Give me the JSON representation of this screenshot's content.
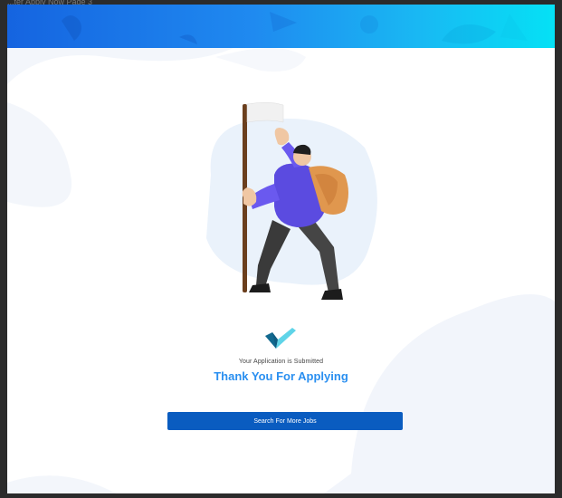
{
  "window": {
    "title": "...ter Apply Now Page 3"
  },
  "confirmation": {
    "subtitle": "Your Application is Submitted",
    "title": "Thank You For Applying"
  },
  "actions": {
    "search_more_jobs_label": "Search For More Jobs"
  },
  "icons": {
    "check": "checkmark-icon",
    "illustration": "hiker-with-flag-illustration"
  },
  "colors": {
    "banner_start": "#1564e0",
    "banner_end": "#05e1f5",
    "title_text": "#2a8ff0",
    "button_bg": "#0a5cc0",
    "check_dark": "#12698f",
    "check_light": "#5fd4e8"
  }
}
